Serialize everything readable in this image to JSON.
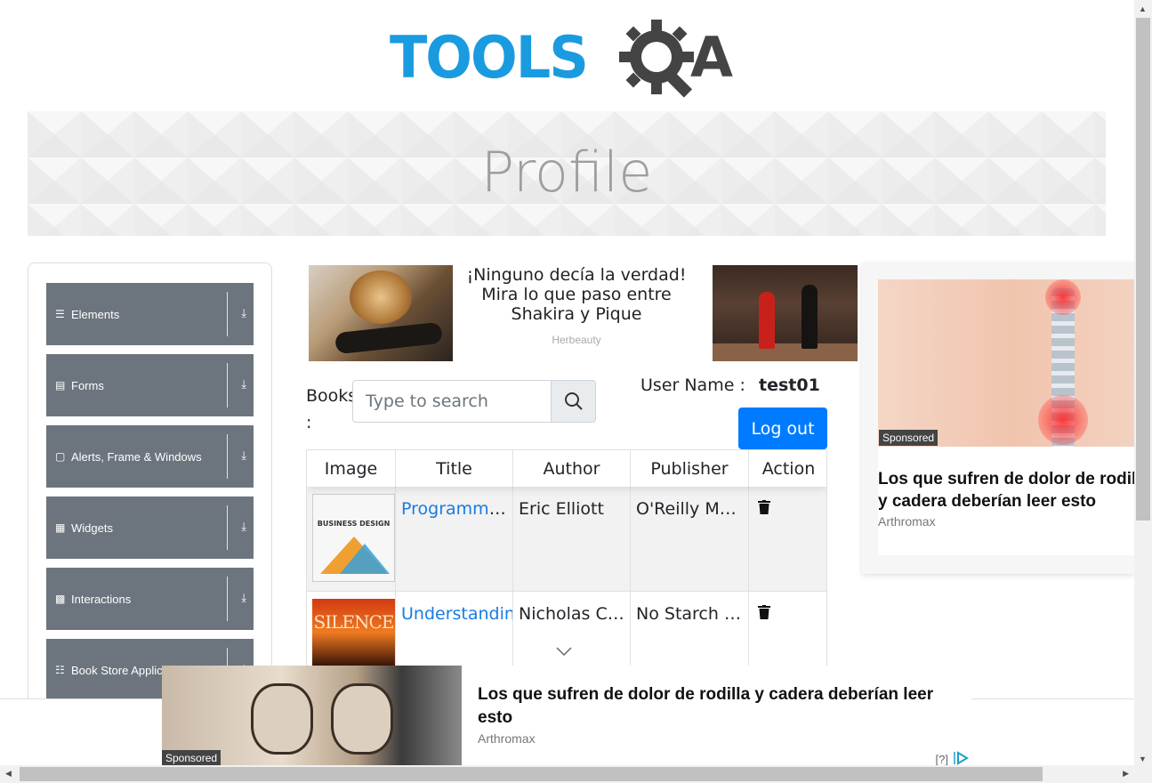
{
  "logo": {
    "text": "TOOLS",
    "q": "Q",
    "a": "A"
  },
  "banner": {
    "title": "Profile"
  },
  "sidebar": {
    "groups": [
      {
        "label": "Elements",
        "icon": "menu-icon"
      },
      {
        "label": "Forms",
        "icon": "form-icon"
      },
      {
        "label": "Alerts, Frame & Windows",
        "icon": "window-icon"
      },
      {
        "label": "Widgets",
        "icon": "widgets-icon"
      },
      {
        "label": "Interactions",
        "icon": "interactions-icon"
      },
      {
        "label": "Book Store Applica",
        "icon": "books-icon"
      }
    ]
  },
  "ad_top": {
    "headline": "¡Ninguno decía la verdad! Mira lo que paso entre Shakira y Pique",
    "source": "Herbeauty"
  },
  "books": {
    "label": "Books :",
    "search_placeholder": "Type to search"
  },
  "user": {
    "label": "User Name :",
    "value": "test01",
    "logout_label": "Log out"
  },
  "table": {
    "headers": [
      "Image",
      "Title",
      "Author",
      "Publisher",
      "Action"
    ],
    "rows": [
      {
        "cover_text": "BUSINESS DESIGN",
        "title": "Programming",
        "author": "Eric Elliott",
        "publisher": "O'Reilly Me..."
      },
      {
        "cover_text": "SILENCE",
        "title": "Understanding",
        "author": "Nicholas C. ...",
        "publisher": "No Starch P..."
      }
    ]
  },
  "ad_right": {
    "sponsored": "Sponsored",
    "headline": "Los que sufren de dolor de rodilla y cadera deberían leer esto",
    "source": "Arthromax"
  },
  "ad_bottom": {
    "sponsored": "Sponsored",
    "headline": "Los que sufren de dolor de rodilla y cadera deberían leer esto",
    "source": "Arthromax",
    "info": "[?]"
  },
  "colors": {
    "accent": "#007bff",
    "sidebar": "#6c757d",
    "logo": "#1a9be0"
  }
}
